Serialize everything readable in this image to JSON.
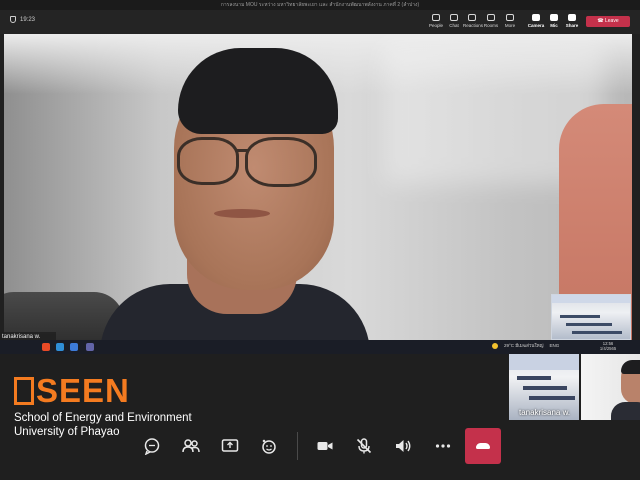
{
  "shared_window": {
    "title": "การลงนาม MOU ระหว่าง มหาวิทยาลัยพะเยา และ สำนักงานพัฒนาพลังงาน ภาคที่ 2 (ลำปาง)",
    "meeting_timer": "19:23",
    "toolbar": [
      {
        "label": "People",
        "icon": "people-icon"
      },
      {
        "label": "Chat",
        "icon": "chat-icon"
      },
      {
        "label": "Reactions",
        "icon": "reactions-icon"
      },
      {
        "label": "Rooms",
        "icon": "rooms-icon"
      },
      {
        "label": "More",
        "icon": "more-icon"
      },
      {
        "label": "Camera",
        "icon": "camera-icon"
      },
      {
        "label": "Mic",
        "icon": "mic-icon"
      },
      {
        "label": "Share",
        "icon": "share-icon"
      }
    ],
    "leave_label": "Leave",
    "participant_name": "tanakrisana w.",
    "taskbar": {
      "weather": "29°C มีเมฆส่วนใหญ่",
      "lang": "ENG",
      "time": "12:56",
      "date": "1/4/2565"
    }
  },
  "branding": {
    "logo_text": "SEEN",
    "line1": "School of Energy and Environment",
    "line2": "University of Phayao",
    "accent": "#f47b20"
  },
  "participants": [
    {
      "name": "tanakrisana w."
    }
  ],
  "controls": [
    {
      "name": "chat-button",
      "icon": "chat-icon"
    },
    {
      "name": "people-button",
      "icon": "people-icon"
    },
    {
      "name": "share-screen-button",
      "icon": "share-screen-icon"
    },
    {
      "name": "reactions-button",
      "icon": "reactions-icon"
    },
    {
      "name": "camera-button",
      "icon": "camera-icon"
    },
    {
      "name": "mic-button",
      "icon": "mic-off-icon"
    },
    {
      "name": "speaker-button",
      "icon": "speaker-icon"
    },
    {
      "name": "more-button",
      "icon": "more-icon"
    },
    {
      "name": "end-call-button",
      "icon": "end-call-icon"
    }
  ],
  "colors": {
    "leave": "#c4314b",
    "end_call": "#c4314b",
    "background": "#1f1f1f"
  }
}
